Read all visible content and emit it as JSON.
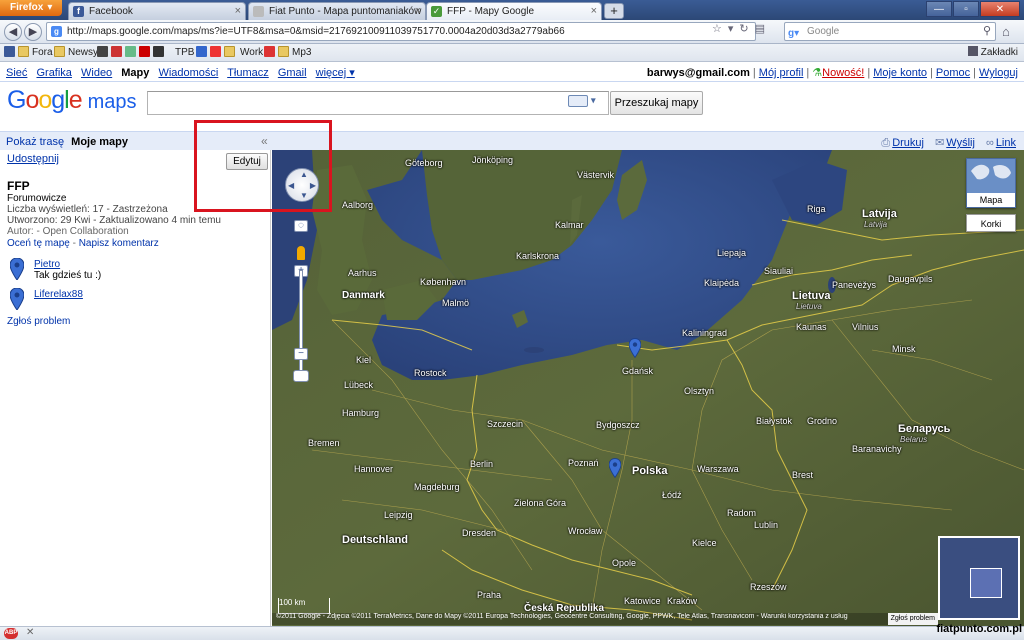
{
  "browser": {
    "menu_button": "Firefox",
    "tabs": [
      {
        "label": "Facebook",
        "active": false
      },
      {
        "label": "Fiat Punto - Mapa puntomaniaków",
        "active": false
      },
      {
        "label": "FFP - Mapy Google",
        "active": true
      }
    ],
    "new_tab": "+",
    "url": "http://maps.google.com/maps/ms?ie=UTF8&msa=0&msid=217692100911039751770.0004a20d03d3a2779ab66",
    "search_placeholder": "Google",
    "bookmarks": [
      "Fora",
      "Newsy",
      "TPB",
      "Work",
      "Mp3"
    ],
    "bookmarks_right": "Zakładki"
  },
  "google_bar": {
    "left": [
      "Sieć",
      "Grafika",
      "Wideo",
      "Mapy",
      "Wiadomości",
      "Tłumacz",
      "Gmail",
      "więcej ▾"
    ],
    "current": "Mapy",
    "email": "barwys@gmail.com",
    "my_profile": "Mój profil",
    "new": "Nowość!",
    "account": "Moje konto",
    "help": "Pomoc",
    "logout": "Wyloguj"
  },
  "logo": {
    "google": "Google",
    "maps": "maps"
  },
  "search": {
    "button": "Przeszukaj mapy",
    "value": ""
  },
  "panel": {
    "tab_route": "Pokaż trasę",
    "tab_mymaps": "Moje mapy",
    "print": "Drukuj",
    "send": "Wyślij",
    "link": "Link"
  },
  "mymap": {
    "share": "Udostępnij",
    "edit": "Edytuj",
    "title": "FFP",
    "category": "Forumowicze",
    "views": "Liczba wyświetleń: 17 - Zastrzeżona",
    "created": "Utworzono: 29 Kwi - Zaktualizowano 4 min temu",
    "author": "Autor:  - Open Collaboration",
    "rate": "Oceń tę mapę",
    "comment": "Napisz komentarz",
    "places": [
      {
        "name": "Pietro",
        "desc": "Tak gdzieś tu :)"
      },
      {
        "name": "Liferelax88",
        "desc": ""
      }
    ],
    "report": "Zgłoś problem"
  },
  "map": {
    "type_button": "Mapa",
    "terrain_button": "Korki",
    "report": "Zgłoś problem",
    "copyright": "©2011 Google - Zdjęcia ©2011 TerraMetrics, Dane do Mapy ©2011 Europa Technologies, Geocentre Consulting, Google, PPWK, Tele Atlas, Transnavicom - Warunki korzystania z usług",
    "countries": [
      "Danmark",
      "Deutschland",
      "Polska",
      "Česká Republika",
      "Lietuva",
      "Latvija",
      "Беларусь"
    ],
    "countries_sub": [
      "Lietuva",
      "Latvija",
      "Belarus"
    ],
    "cities": [
      "Göteborg",
      "Jönköping",
      "Västervik",
      "Kalmar",
      "Karlskrona",
      "Malmö",
      "København",
      "Aalborg",
      "Aarhus",
      "Kiel",
      "Hamburg",
      "Bremen",
      "Hannover",
      "Berlin",
      "Magdeburg",
      "Leipzig",
      "Dresden",
      "Szczecin",
      "Gdańsk",
      "Bydgoszcz",
      "Poznań",
      "Łódź",
      "Warszawa",
      "Wrocław",
      "Kraków",
      "Katowice",
      "Kaunas",
      "Vilnius",
      "Riga",
      "Klaipėda",
      "Kaliningrad",
      "Olsztyn",
      "Lublin",
      "Grodno",
      "Brest",
      "Rostock",
      "Lübeck",
      "Praha",
      "Zielona Góra",
      "Opole",
      "Kielce",
      "Rzeszów",
      "Radom",
      "Białystok",
      "Siauliai",
      "Panevėžys",
      "Daugavpils",
      "Liepaja",
      "Baranavichy",
      "Minsk"
    ],
    "scale": "100 km"
  },
  "watermark": "fiatpunto.com.pl"
}
